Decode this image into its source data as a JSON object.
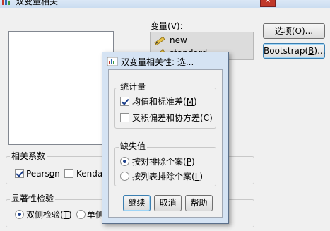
{
  "window": {
    "title": "双变量相关",
    "close_glyph": "✕"
  },
  "variables": {
    "label": "变量(",
    "label_key": "V",
    "label_end": "):",
    "items": [
      {
        "name": "new",
        "icon": "ruler-pencil-icon"
      },
      {
        "name": "standard",
        "icon": "ruler-pencil-icon"
      }
    ]
  },
  "side_buttons": {
    "options": {
      "label": "选项(",
      "key": "O",
      "end": ")..."
    },
    "bootstrap": {
      "label": "Bootstrap(",
      "key": "B",
      "end": ")..."
    }
  },
  "correlation": {
    "title": "相关系数",
    "pearson": {
      "label": "Pears",
      "key": "o",
      "end": "n",
      "checked": true
    },
    "kendall": {
      "label": "Kenda",
      "checked": false
    }
  },
  "significance": {
    "title": "显著性检验",
    "two_tailed": {
      "label": "双侧检验(",
      "key": "T",
      "end": ")",
      "selected": true
    },
    "one_tailed": {
      "label": "单侧",
      "selected": false
    }
  },
  "dialog": {
    "title": "双变量相关性: 选...",
    "stats_group": {
      "title": "统计量",
      "means": {
        "label": "均值和标准差(",
        "key": "M",
        "end": ")",
        "checked": true
      },
      "crossprod": {
        "label": "叉积偏差和协方差(",
        "key": "C",
        "end": ")",
        "checked": false
      }
    },
    "missing_group": {
      "title": "缺失值",
      "pairwise": {
        "label": "按对排除个案(",
        "key": "P",
        "end": ")",
        "selected": true
      },
      "listwise": {
        "label": "按列表排除个案(",
        "key": "L",
        "end": ")",
        "selected": false
      }
    },
    "buttons": {
      "continue": "继续",
      "cancel": "取消",
      "help": "帮助"
    }
  }
}
